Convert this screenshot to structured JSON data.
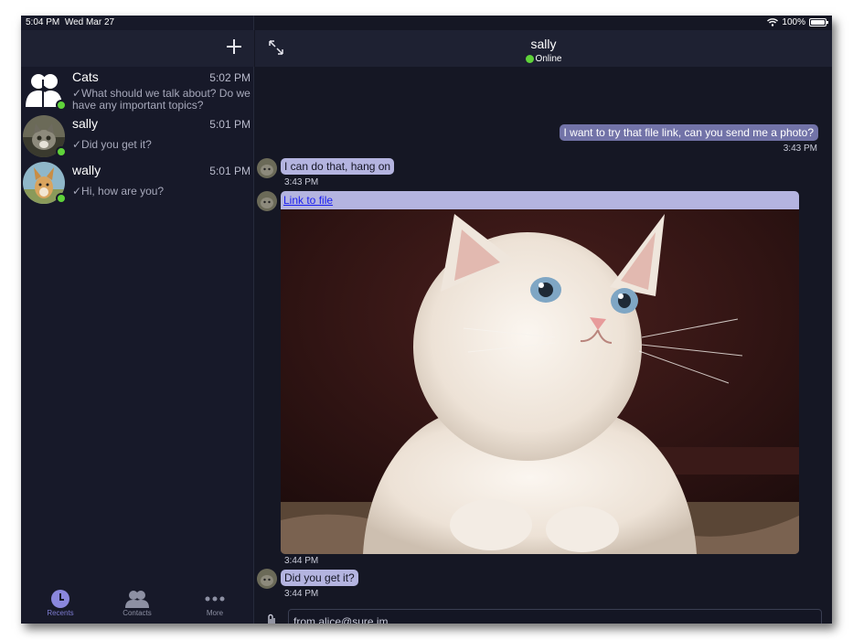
{
  "status_bar": {
    "time": "5:04 PM",
    "date": "Wed Mar 27",
    "battery": "100%"
  },
  "sidebar": {
    "conversations": [
      {
        "name": "Cats",
        "time": "5:02 PM",
        "preview": "✓What should we talk about? Do we have any important topics?",
        "online": true
      },
      {
        "name": "sally",
        "time": "5:01 PM",
        "preview": "✓Did you get it?",
        "online": true
      },
      {
        "name": "wally",
        "time": "5:01 PM",
        "preview": "✓Hi, how are you?",
        "online": true
      }
    ],
    "tabs": [
      {
        "label": "Recents",
        "icon": "clock-icon",
        "active": true
      },
      {
        "label": "Contacts",
        "icon": "contacts-icon",
        "active": false
      },
      {
        "label": "More",
        "icon": "more-icon",
        "active": false
      }
    ]
  },
  "chat": {
    "title": "sally",
    "status": "Online",
    "messages": [
      {
        "direction": "out",
        "text": "I want to try that file link, can you send me a photo?",
        "time": "3:43 PM"
      },
      {
        "direction": "in",
        "text": "I can do that, hang on",
        "time": "3:43 PM"
      },
      {
        "direction": "in",
        "type": "file",
        "link_text": "Link to file",
        "image": "white kitten photo",
        "time": "3:44 PM"
      },
      {
        "direction": "in",
        "text": "Did you get it?",
        "time": "3:44 PM"
      }
    ],
    "composer": {
      "placeholder": "from alice@sure.im..."
    }
  },
  "colors": {
    "accent": "#8a87dd",
    "online": "#5fd33a",
    "bubble_in": "#b4b4e0",
    "bubble_out": "#7273a8",
    "background": "#151724"
  }
}
